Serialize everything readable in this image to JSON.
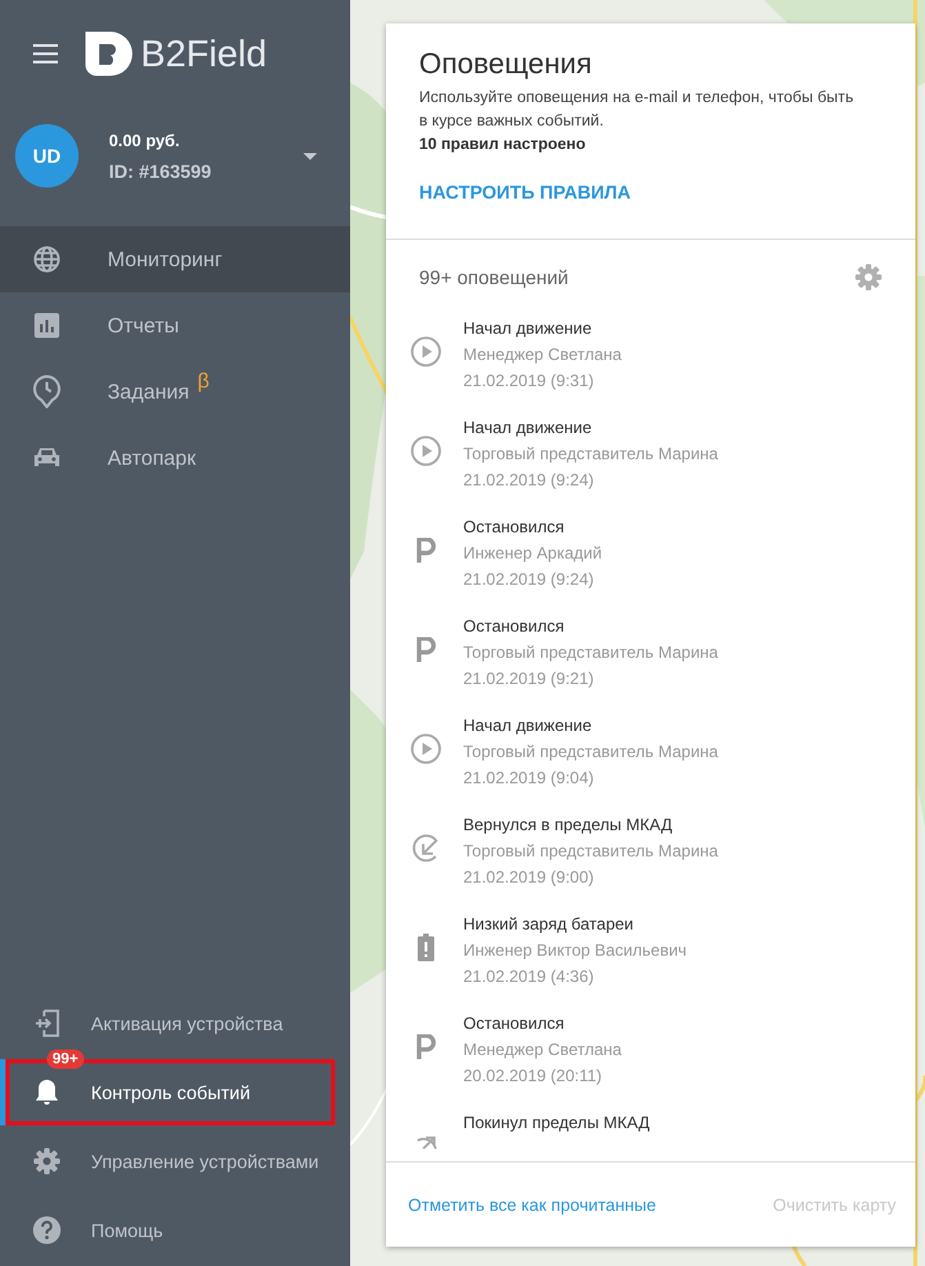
{
  "sidebar": {
    "logo": "B2Field",
    "user": {
      "initials": "UD",
      "balance": "0.00 руб.",
      "id": "ID: #163599"
    },
    "menu": [
      {
        "kind": "globe",
        "label": "Мониторинг",
        "selected": true
      },
      {
        "kind": "chart",
        "label": "Отчеты",
        "selected": false
      },
      {
        "kind": "clock",
        "label": "Задания",
        "selected": false,
        "badge": "β"
      },
      {
        "kind": "car",
        "label": "Автопарк",
        "selected": false
      }
    ],
    "bottom_menu": [
      {
        "kind": "device",
        "label": "Активация устройства",
        "selected": false
      },
      {
        "kind": "bell",
        "label": "Контроль событий",
        "selected": true,
        "badge": "99+",
        "highlighted": true
      },
      {
        "kind": "gear",
        "label": "Управление устройствами",
        "selected": false
      },
      {
        "kind": "help",
        "label": "Помощь",
        "selected": false
      }
    ]
  },
  "panel": {
    "title": "Оповещения",
    "description": "Используйте оповещения на e-mail и телефон, чтобы быть в курсе важных событий.",
    "rules_count": "10 правил настроено",
    "configure_link": "НАСТРОИТЬ ПРАВИЛА",
    "count": "99+ оповещений",
    "notifications": [
      {
        "kind": "start",
        "title": "Начал движение",
        "subtitle": "Менеджер Светлана",
        "date": "21.02.2019 (9:31)"
      },
      {
        "kind": "start",
        "title": "Начал движение",
        "subtitle": "Торговый представитель Марина",
        "date": "21.02.2019 (9:24)"
      },
      {
        "kind": "stop",
        "title": "Остановился",
        "subtitle": "Инженер Аркадий",
        "date": "21.02.2019 (9:24)"
      },
      {
        "kind": "stop",
        "title": "Остановился",
        "subtitle": "Торговый представитель Марина",
        "date": "21.02.2019 (9:21)"
      },
      {
        "kind": "start",
        "title": "Начал движение",
        "subtitle": "Торговый представитель Марина",
        "date": "21.02.2019 (9:04)"
      },
      {
        "kind": "enter",
        "title": "Вернулся в пределы МКАД",
        "subtitle": "Торговый представитель Марина",
        "date": "21.02.2019 (9:00)"
      },
      {
        "kind": "battery",
        "title": "Низкий заряд батареи",
        "subtitle": "Инженер Виктор Васильевич",
        "date": "21.02.2019 (4:36)"
      },
      {
        "kind": "stop",
        "title": "Остановился",
        "subtitle": "Менеджер Светлана",
        "date": "20.02.2019 (20:11)"
      },
      {
        "kind": "leave",
        "title": "Покинул пределы МКАД"
      }
    ],
    "footer": {
      "mark_read": "Отметить все как прочитанные",
      "clear_map": "Очистить карту",
      "clear_disabled": true
    }
  }
}
